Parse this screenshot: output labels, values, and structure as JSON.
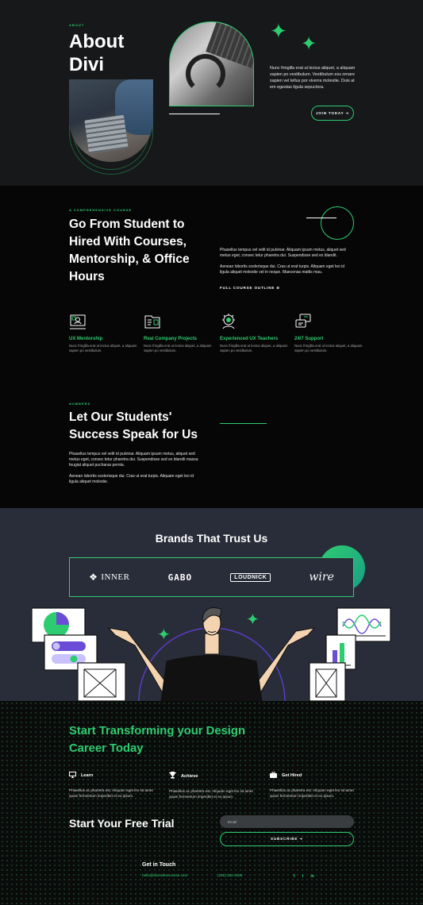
{
  "hero": {
    "eyebrow": "ABOUT",
    "title": "About Divi",
    "description": "Nunc fringilla erat ut lectus aliquet, a aliquam sapien po vestibulum. Vestibulum ess ornare sapien vel tellus por viverra molestie. Duis at em egestas ligula sepuctora.",
    "cta": "JOIN TODAY ➔"
  },
  "course": {
    "eyebrow": "A COMPREHENSIVE COURSE",
    "title": "Go From Student to Hired With Courses, Mentorship, & Office Hours",
    "para1": "Phasellus tempus vel velit id pulvinar. Aliquam ipsum metus, aliquet sed metus eget, consec tetur pharetra dui. Suspendisse sed ex blandit.",
    "para2": "Aenean lobortis scelerisque dui. Cras ut erat turpis. Aliquam eget leo id ligula aliquet molestie vel in neque. Maecenas mattis mau.",
    "outline_link": "FULL COURSE OUTLINE ⊕",
    "features": [
      {
        "icon": "mentorship-icon",
        "title": "UX Mentorship",
        "desc": "Nunc fringilla erat ut lectus aliquet, a aliquam sapien po vestibulum."
      },
      {
        "icon": "projects-icon",
        "title": "Real Company Projects",
        "desc": "Nunc fringilla erat ut lectus aliquet, a aliquam sapien po vestibulum."
      },
      {
        "icon": "teachers-icon",
        "title": "Experienced UX Teachers",
        "desc": "Nunc fringilla erat ut lectus aliquet, a aliquam sapien po vestibulum."
      },
      {
        "icon": "support-icon",
        "title": "24/7 Support",
        "desc": "Nunc fringilla erat ut lectus aliquet, a aliquam sapien po vestibulum."
      }
    ]
  },
  "numbers": {
    "eyebrow": "NUMBERS",
    "title": "Let Our Students' Success Speak for Us",
    "para1": "Phasellus tempus vel velit id pulvinar. Aliquam ipsum metus, aliquet sed metus eget, consec tetur pharetra dui. Suspendisse sed ex blandit massa feugiat aliquet pucharas pernta.",
    "para2": "Aenean lobortis scelerisque dui. Cras ut erat turpis. Aliquam eget leo id ligula aliquet molestie."
  },
  "brands": {
    "title": "Brands That Trust Us",
    "logos": [
      "INNER",
      "GABO",
      "LOUDNICK",
      "wire"
    ]
  },
  "trial": {
    "title": "Start Transforming your Design Career Today",
    "columns": [
      {
        "icon": "monitor-icon",
        "label": "Learn",
        "text": "Phasellus ac pharetra est. Aliquam eget leo sit amet quam fermentum imperdiet et eu ipsum."
      },
      {
        "icon": "trophy-icon",
        "label": "Achieve",
        "text": "Phasellus ac pharetra est. Aliquam eget leo sit amet quam fermentum imperdiet et eu ipsum."
      },
      {
        "icon": "briefcase-icon",
        "label": "Get Hired",
        "text": "Phasellus ac pharetra est. Aliquam eget leo sit amet quam fermentum imperdiet et eu ipsum."
      }
    ],
    "free_trial": "Start Your Free Trial",
    "email_placeholder": "Email",
    "subscribe": "SUBSCRIBE ➔"
  },
  "contact": {
    "heading": "Get in Touch",
    "email": "hello@divionlinecourse.com",
    "phone": "(255) 352-6258",
    "socials": [
      "f",
      "t",
      "in"
    ]
  },
  "colors": {
    "accent": "#2ecc71",
    "bg_dark": "#16181a",
    "bg_mid": "#292d39"
  }
}
